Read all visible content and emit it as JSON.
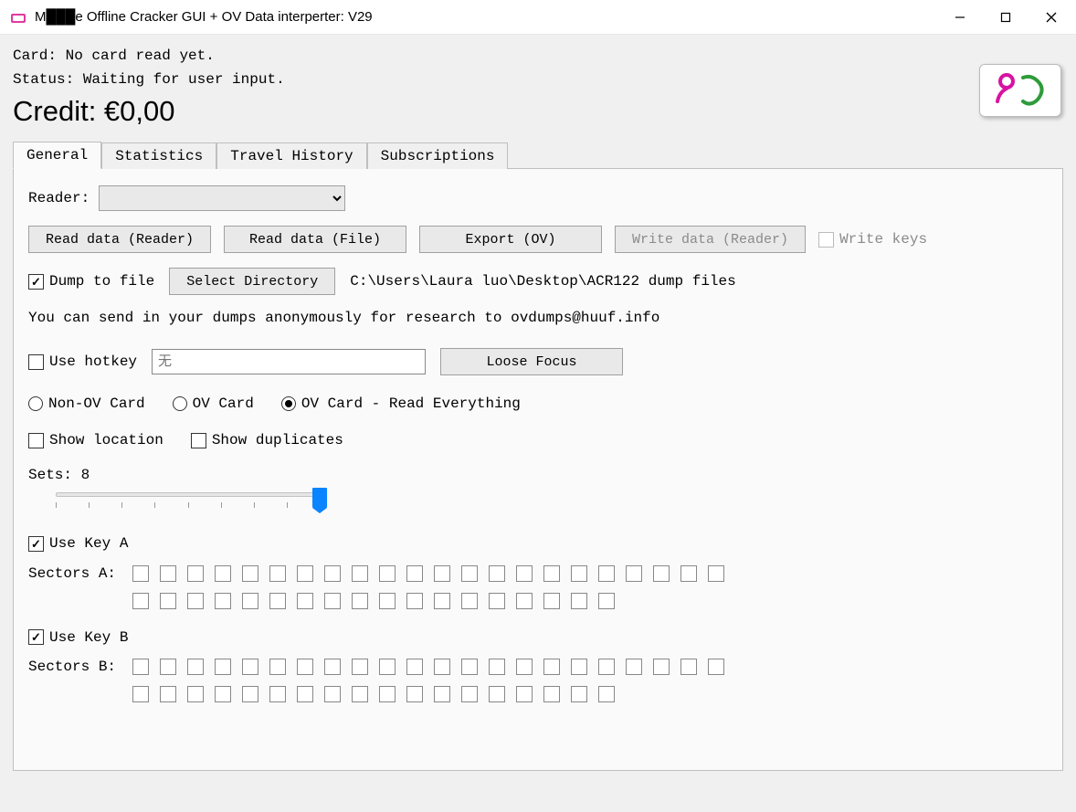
{
  "window": {
    "title": "M███e Offline Cracker GUI + OV Data interperter: V29"
  },
  "header": {
    "card_label": "Card:",
    "card_value": "No card read yet.",
    "status_label": "Status:",
    "status_value": "Waiting for user input.",
    "credit": "Credit: €0,00"
  },
  "tabs": {
    "general": "General",
    "statistics": "Statistics",
    "travel_history": "Travel History",
    "subscriptions": "Subscriptions"
  },
  "general": {
    "reader_label": "Reader:",
    "buttons": {
      "read_reader": "Read data (Reader)",
      "read_file": "Read data (File)",
      "export_ov": "Export (OV)",
      "write_reader": "Write data (Reader)",
      "write_keys": "Write keys"
    },
    "dump_to_file": "Dump to file",
    "select_directory": "Select Directory",
    "dump_path": "C:\\Users\\Laura luo\\Desktop\\ACR122 dump files",
    "info": "You can send in your dumps anonymously for research to ovdumps@huuf.info",
    "use_hotkey": "Use hotkey",
    "hotkey_placeholder": "无",
    "loose_focus": "Loose Focus",
    "radios": {
      "non_ov": "Non-OV Card",
      "ov": "OV Card",
      "ov_all": "OV Card - Read Everything"
    },
    "show_location": "Show location",
    "show_duplicates": "Show duplicates",
    "sets_label": "Sets: 8",
    "use_key_a": "Use Key A",
    "sectors_a": "Sectors A:",
    "use_key_b": "Use Key B",
    "sectors_b": "Sectors B:"
  }
}
